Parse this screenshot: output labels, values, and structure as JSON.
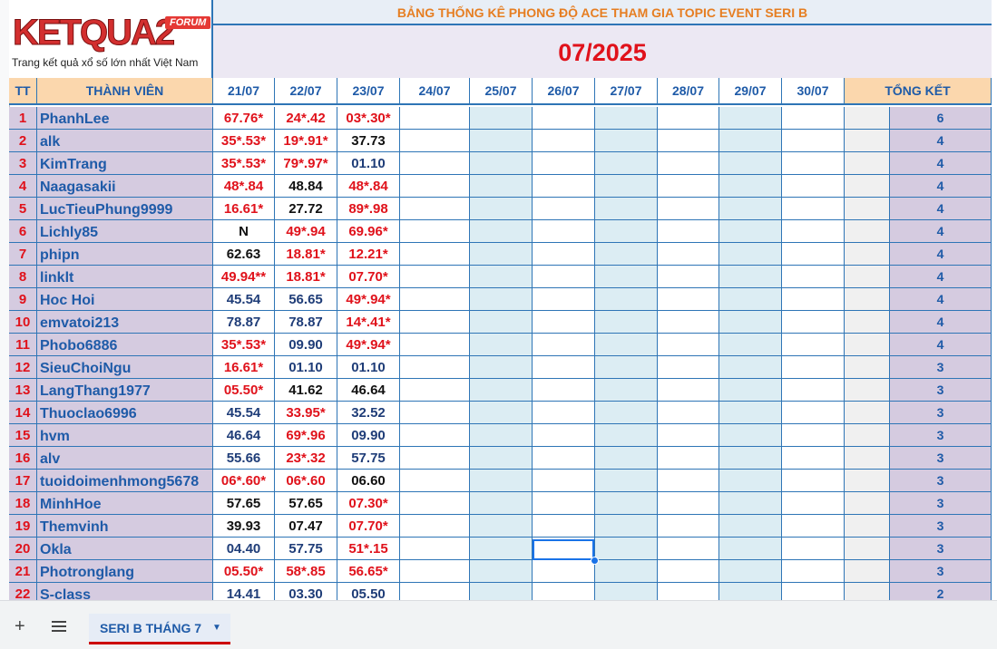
{
  "header": {
    "logo_text": "KETQUA2",
    "logo_badge": "FORUM",
    "logo_tagline": "Trang kết quả xổ số lớn nhất Việt Nam",
    "banner": "BẢNG THỐNG KÊ PHONG ĐỘ ACE THAM GIA TOPIC EVENT SERI B",
    "month": "07/2025"
  },
  "columns": {
    "tt": "TT",
    "member": "THÀNH VIÊN",
    "dates": [
      "21/07",
      "22/07",
      "23/07",
      "24/07",
      "25/07",
      "26/07",
      "27/07",
      "28/07",
      "29/07",
      "30/07"
    ],
    "total": "TỔNG KẾT"
  },
  "rows": [
    {
      "tt": "1",
      "name": "PhanhLee",
      "v": [
        "67.76*",
        "24*.42",
        "03*.30*"
      ],
      "c": [
        "r",
        "r",
        "r"
      ],
      "total": "6"
    },
    {
      "tt": "2",
      "name": "alk",
      "v": [
        "35*.53*",
        "19*.91*",
        "37.73"
      ],
      "c": [
        "r",
        "r",
        "k"
      ],
      "total": "4"
    },
    {
      "tt": "3",
      "name": "KimTrang",
      "v": [
        "35*.53*",
        "79*.97*",
        "01.10"
      ],
      "c": [
        "r",
        "r",
        "b"
      ],
      "total": "4"
    },
    {
      "tt": "4",
      "name": "Naagasakii",
      "v": [
        "48*.84",
        "48.84",
        "48*.84"
      ],
      "c": [
        "r",
        "k",
        "r"
      ],
      "total": "4"
    },
    {
      "tt": "5",
      "name": "LucTieuPhung9999",
      "v": [
        "16.61*",
        "27.72",
        "89*.98"
      ],
      "c": [
        "r",
        "k",
        "r"
      ],
      "total": "4"
    },
    {
      "tt": "6",
      "name": "Lichly85",
      "v": [
        "N",
        "49*.94",
        "69.96*"
      ],
      "c": [
        "k",
        "r",
        "r"
      ],
      "total": "4"
    },
    {
      "tt": "7",
      "name": "phipn",
      "v": [
        "62.63",
        "18.81*",
        "12.21*"
      ],
      "c": [
        "k",
        "r",
        "r"
      ],
      "total": "4"
    },
    {
      "tt": "8",
      "name": "linklt",
      "v": [
        "49.94**",
        "18.81*",
        "07.70*"
      ],
      "c": [
        "r",
        "r",
        "r"
      ],
      "total": "4"
    },
    {
      "tt": "9",
      "name": "Hoc Hoi",
      "v": [
        "45.54",
        "56.65",
        "49*.94*"
      ],
      "c": [
        "b",
        "b",
        "r"
      ],
      "total": "4"
    },
    {
      "tt": "10",
      "name": "emvatoi213",
      "v": [
        "78.87",
        "78.87",
        "14*.41*"
      ],
      "c": [
        "b",
        "b",
        "r"
      ],
      "total": "4"
    },
    {
      "tt": "11",
      "name": "Phobo6886",
      "v": [
        "35*.53*",
        "09.90",
        "49*.94*"
      ],
      "c": [
        "r",
        "b",
        "r"
      ],
      "total": "4"
    },
    {
      "tt": "12",
      "name": "SieuChoiNgu",
      "v": [
        "16.61*",
        "01.10",
        "01.10"
      ],
      "c": [
        "r",
        "b",
        "b"
      ],
      "total": "3"
    },
    {
      "tt": "13",
      "name": "LangThang1977",
      "v": [
        "05.50*",
        "41.62",
        "46.64"
      ],
      "c": [
        "r",
        "k",
        "k"
      ],
      "total": "3"
    },
    {
      "tt": "14",
      "name": "Thuoclao6996",
      "v": [
        "45.54",
        "33.95*",
        "32.52"
      ],
      "c": [
        "b",
        "r",
        "b"
      ],
      "total": "3"
    },
    {
      "tt": "15",
      "name": "hvm",
      "v": [
        "46.64",
        "69*.96",
        "09.90"
      ],
      "c": [
        "b",
        "r",
        "b"
      ],
      "total": "3"
    },
    {
      "tt": "16",
      "name": "alv",
      "v": [
        "55.66",
        "23*.32",
        "57.75"
      ],
      "c": [
        "b",
        "r",
        "b"
      ],
      "total": "3"
    },
    {
      "tt": "17",
      "name": "tuoidoimenhmong5678",
      "v": [
        "06*.60*",
        "06*.60",
        "06.60"
      ],
      "c": [
        "r",
        "r",
        "k"
      ],
      "total": "3"
    },
    {
      "tt": "18",
      "name": "MinhHoe",
      "v": [
        "57.65",
        "57.65",
        "07.30*"
      ],
      "c": [
        "k",
        "k",
        "r"
      ],
      "total": "3"
    },
    {
      "tt": "19",
      "name": "Themvinh",
      "v": [
        "39.93",
        "07.47",
        "07.70*"
      ],
      "c": [
        "k",
        "k",
        "r"
      ],
      "total": "3"
    },
    {
      "tt": "20",
      "name": "Okla",
      "v": [
        "04.40",
        "57.75",
        "51*.15"
      ],
      "c": [
        "b",
        "b",
        "r"
      ],
      "total": "3"
    },
    {
      "tt": "21",
      "name": "Photronglang",
      "v": [
        "05.50*",
        "58*.85",
        "56.65*"
      ],
      "c": [
        "r",
        "r",
        "r"
      ],
      "total": "3"
    },
    {
      "tt": "22",
      "name": "S-class",
      "v": [
        "14.41",
        "03.30",
        "05.50"
      ],
      "c": [
        "b",
        "b",
        "b"
      ],
      "total": "2"
    }
  ],
  "tabbar": {
    "add_icon": "+",
    "sheet_tab": "SERI B THÁNG 7",
    "caret": "▼"
  },
  "colors": {
    "red": "#e0121b",
    "blue": "#1f5ba8",
    "lilac": "#d5cbe0",
    "tan": "#fbd7ad",
    "lightblue": "#dcedf3"
  }
}
